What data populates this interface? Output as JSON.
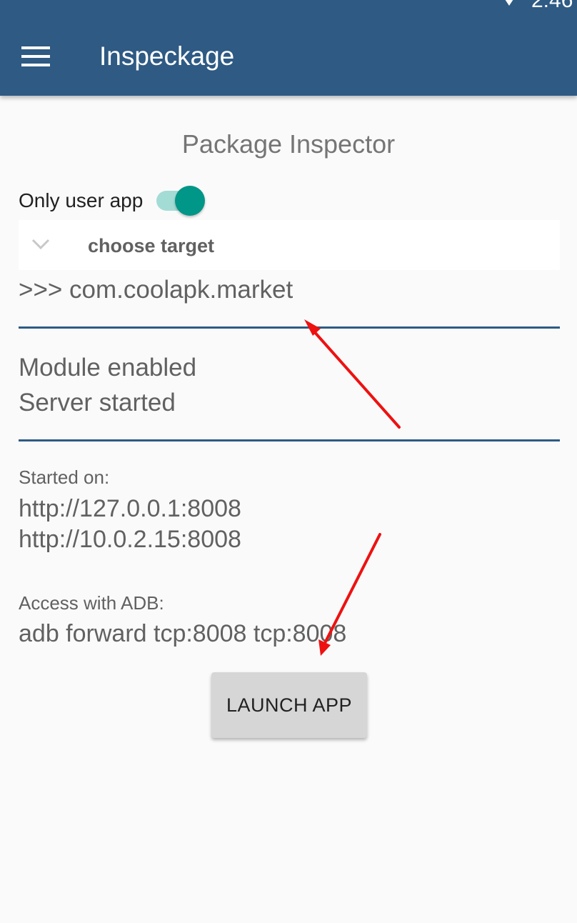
{
  "status_bar": {
    "time": "2:46",
    "wifi_icon": "wifi-icon"
  },
  "app_bar": {
    "menu_icon": "hamburger-menu-icon",
    "title": "Inspeckage",
    "color": "#2e5a84"
  },
  "main": {
    "section_title": "Package Inspector",
    "only_user_app": {
      "label": "Only user app",
      "checked": true,
      "accent": "#009688"
    },
    "target_spinner": {
      "icon": "chevron-down-icon",
      "value": "choose target"
    },
    "selected_package": ">>> com.coolapk.market",
    "status_lines": [
      "Module enabled",
      "Server started"
    ],
    "started_on": {
      "label": "Started on:",
      "urls": [
        "http://127.0.0.1:8008",
        "http://10.0.2.15:8008"
      ]
    },
    "adb": {
      "label": "Access with ADB:",
      "command": "adb forward tcp:8008 tcp:8008"
    },
    "launch_button": "LAUNCH APP"
  },
  "annotations": {
    "arrow_color": "#ee1111",
    "arrow_icon": "red-arrow-annotation"
  }
}
